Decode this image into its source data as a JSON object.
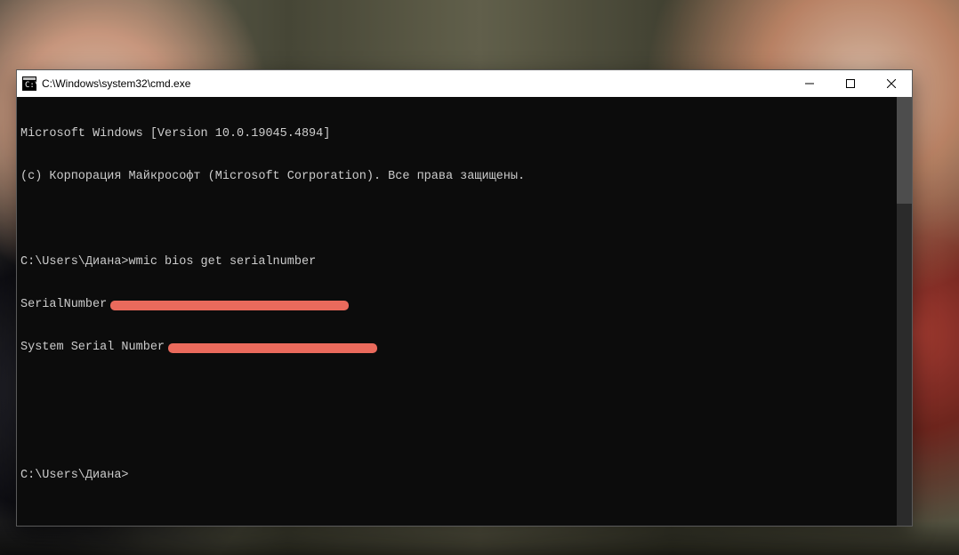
{
  "window": {
    "title": "C:\\Windows\\system32\\cmd.exe"
  },
  "terminal": {
    "line1": "Microsoft Windows [Version 10.0.19045.4894]",
    "line2": "(c) Корпорация Майкрософт (Microsoft Corporation). Все права защищены.",
    "blank": "",
    "prompt1_prefix": "C:\\Users\\Диана>",
    "prompt1_cmd": "wmic bios get serialnumber",
    "out1_label": "SerialNumber",
    "out2_label": "System Serial Number",
    "prompt2": "C:\\Users\\Диана>"
  }
}
